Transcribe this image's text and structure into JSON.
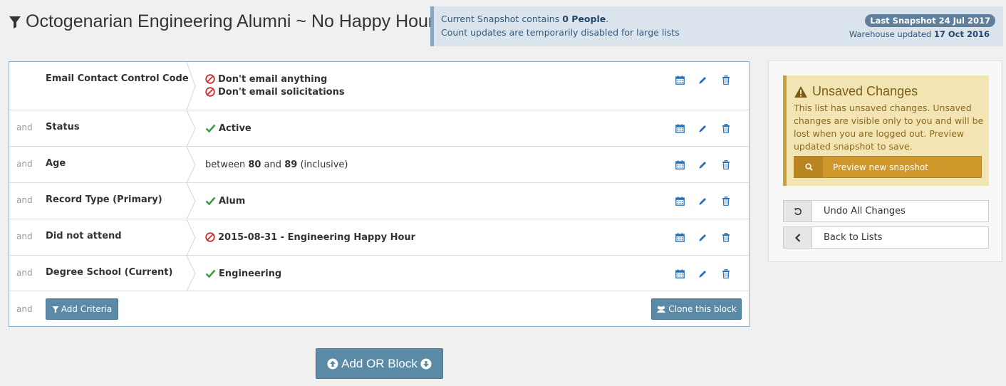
{
  "page": {
    "title": "Octogenarian Engineering Alumni ~ No Happy Hour"
  },
  "snapshot": {
    "line1_prefix": "Current Snapshot contains",
    "people_count": "0 People",
    "line1_suffix": ".",
    "line2": "Count updates are temporarily disabled for large lists",
    "last_snapshot_badge": "Last Snapshot 24 Jul 2017",
    "warehouse_prefix": "Warehouse updated",
    "warehouse_date": "17 Oct 2016"
  },
  "criteria": {
    "rows": [
      {
        "conjunction": "",
        "field": "Email Contact Control Code",
        "values": [
          {
            "icon": "ban-icon",
            "text": "Don't email anything"
          },
          {
            "icon": "ban-icon",
            "text": "Don't email solicitations"
          }
        ]
      },
      {
        "conjunction": "and",
        "field": "Status",
        "values": [
          {
            "icon": "check-icon",
            "text": "Active"
          }
        ]
      },
      {
        "conjunction": "and",
        "field": "Age",
        "values": [
          {
            "icon": "",
            "text": "",
            "range": {
              "prefix": "between",
              "low": "80",
              "mid": "and",
              "high": "89",
              "suffix": "(inclusive)"
            }
          }
        ]
      },
      {
        "conjunction": "and",
        "field": "Record Type (Primary)",
        "values": [
          {
            "icon": "check-icon",
            "text": "Alum"
          }
        ]
      },
      {
        "conjunction": "and",
        "field": "Did not attend",
        "values": [
          {
            "icon": "ban-icon",
            "text": "2015-08-31 - Engineering Happy Hour"
          }
        ]
      },
      {
        "conjunction": "and",
        "field": "Degree School (Current)",
        "values": [
          {
            "icon": "check-icon",
            "text": "Engineering"
          }
        ]
      }
    ],
    "footer_conjunction": "and",
    "add_criteria_label": "Add Criteria",
    "clone_block_label": "Clone this block"
  },
  "add_or_block_label": "Add OR Block",
  "sidebar": {
    "warning_title": "Unsaved Changes",
    "warning_text": "This list has unsaved changes. Unsaved changes are visible only to you and will be lost when you are logged out. Preview updated snapshot to save.",
    "preview_label": "Preview new snapshot",
    "undo_label": "Undo All Changes",
    "back_label": "Back to Lists"
  },
  "colors": {
    "action_blue": "#5b8aa6",
    "ban_red": "#c9302c",
    "check_green": "#3c9a48",
    "warning_gold": "#d0972a"
  }
}
